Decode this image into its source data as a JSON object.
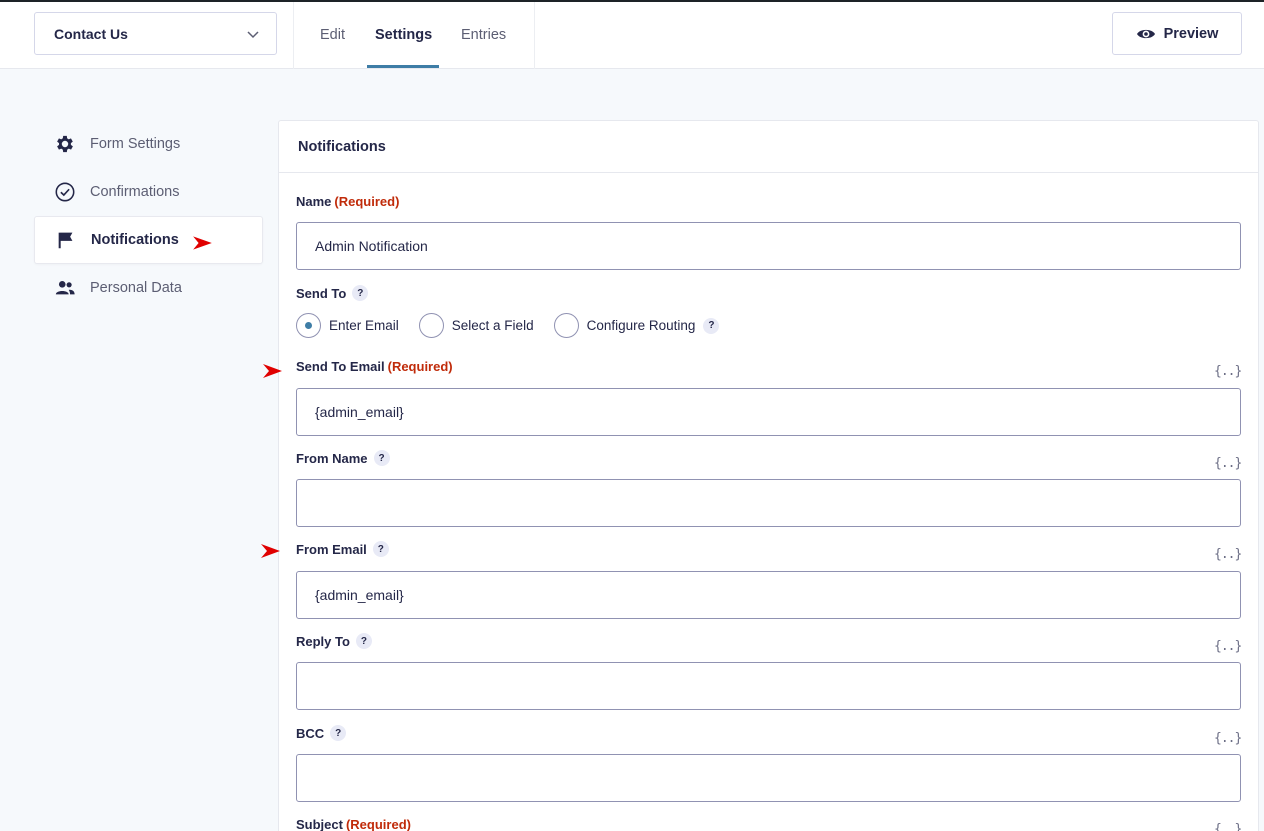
{
  "form_selector": {
    "label": "Contact Us"
  },
  "tabs": [
    {
      "label": "Edit"
    },
    {
      "label": "Settings"
    },
    {
      "label": "Entries"
    }
  ],
  "preview": {
    "label": "Preview"
  },
  "sidebar": {
    "items": [
      {
        "label": "Form Settings",
        "icon": "gear-icon"
      },
      {
        "label": "Confirmations",
        "icon": "check-circle-icon"
      },
      {
        "label": "Notifications",
        "icon": "flag-icon"
      },
      {
        "label": "Personal Data",
        "icon": "users-icon"
      }
    ]
  },
  "panel": {
    "title": "Notifications",
    "required_text": "(Required)",
    "help_glyph": "?",
    "merge_tag_glyph": "{..}",
    "name": {
      "label": "Name",
      "value": "Admin Notification"
    },
    "send_to": {
      "label": "Send To",
      "options": [
        "Enter Email",
        "Select a Field",
        "Configure Routing"
      ],
      "selected": "Enter Email"
    },
    "send_to_email": {
      "label": "Send To Email",
      "value": "{admin_email}"
    },
    "from_name": {
      "label": "From Name",
      "value": ""
    },
    "from_email": {
      "label": "From Email",
      "value": "{admin_email}"
    },
    "reply_to": {
      "label": "Reply To",
      "value": ""
    },
    "bcc": {
      "label": "BCC",
      "value": ""
    },
    "subject": {
      "label": "Subject"
    }
  },
  "colors": {
    "accent": "#3e7da6",
    "required": "#c02b0a",
    "annotation_arrow": "#e00000"
  }
}
